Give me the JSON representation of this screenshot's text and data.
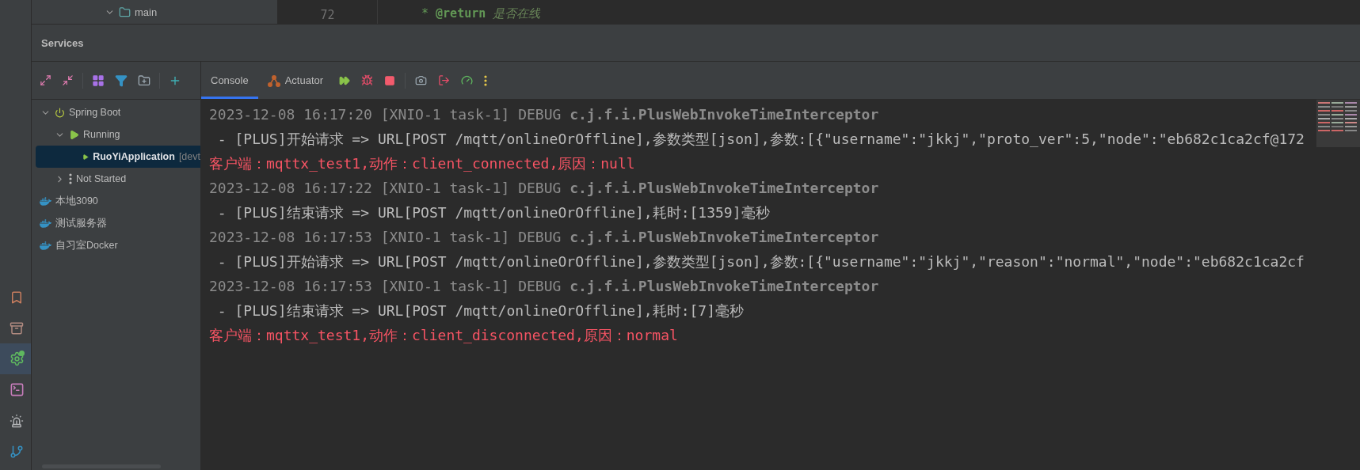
{
  "project_tree": {
    "label": "main",
    "expanded": true
  },
  "editor": {
    "line_number": "72",
    "code": "* **@return** *是否在线*"
  },
  "tool_strip": [
    {
      "kind": "bookmarks",
      "selected": false
    },
    {
      "kind": "archive",
      "selected": false
    },
    {
      "kind": "services",
      "selected": true
    },
    {
      "kind": "terminal",
      "selected": false
    },
    {
      "kind": "alarm",
      "selected": false
    },
    {
      "kind": "git",
      "selected": false
    }
  ],
  "services": {
    "title": "Services",
    "toolbar": [
      {
        "kind": "expand"
      },
      {
        "kind": "collapse"
      },
      {
        "kind": "group"
      },
      {
        "kind": "filter"
      },
      {
        "kind": "add-folder"
      },
      {
        "kind": "add"
      }
    ],
    "tree": [
      {
        "label": "Spring Boot",
        "kind": "spring",
        "expanded": true,
        "selected": false,
        "children": [
          {
            "label": "Running",
            "kind": "running",
            "expanded": true,
            "selected": false,
            "children": [
              {
                "label": "RuoYiApplication",
                "suffix": "[devt",
                "kind": "app",
                "selected": true
              }
            ]
          },
          {
            "label": "Not Started",
            "kind": "not-started",
            "expanded": false,
            "selected": false
          }
        ]
      },
      {
        "label": "本地3090",
        "kind": "docker",
        "selected": false
      },
      {
        "label": "测试服务器",
        "kind": "docker",
        "selected": false
      },
      {
        "label": "自习室Docker",
        "kind": "docker",
        "selected": false
      }
    ]
  },
  "tabs": [
    {
      "label": "Console",
      "kind": "console",
      "selected": true
    },
    {
      "label": "Actuator",
      "kind": "actuator",
      "selected": false
    }
  ],
  "actions": [
    {
      "kind": "rerun"
    },
    {
      "kind": "debug"
    },
    {
      "kind": "stop"
    },
    {
      "kind": "screenshot"
    },
    {
      "kind": "exit"
    },
    {
      "kind": "gauge"
    },
    {
      "kind": "more"
    }
  ],
  "console": [
    {
      "kind": "debug",
      "text": "2023-12-08 16:17:20 [XNIO-1 task-1] DEBUG ",
      "logger": "c.j.f.i.PlusWebInvokeTimeInterceptor"
    },
    {
      "kind": "info",
      "text": " - [PLUS]开始请求 => URL[POST /mqtt/onlineOrOffline],参数类型[json],参数:[{\"username\":\"jkkj\",\"proto_ver\":5,\"node\":\"eb682c1ca2cf@172"
    },
    {
      "kind": "error",
      "text": "客户端：mqttx_test1,动作：client_connected,原因：null"
    },
    {
      "kind": "debug",
      "text": "2023-12-08 16:17:22 [XNIO-1 task-1] DEBUG ",
      "logger": "c.j.f.i.PlusWebInvokeTimeInterceptor"
    },
    {
      "kind": "info",
      "text": " - [PLUS]结束请求 => URL[POST /mqtt/onlineOrOffline],耗时:[1359]毫秒"
    },
    {
      "kind": "debug",
      "text": "2023-12-08 16:17:53 [XNIO-1 task-1] DEBUG ",
      "logger": "c.j.f.i.PlusWebInvokeTimeInterceptor"
    },
    {
      "kind": "info",
      "text": " - [PLUS]开始请求 => URL[POST /mqtt/onlineOrOffline],参数类型[json],参数:[{\"username\":\"jkkj\",\"reason\":\"normal\",\"node\":\"eb682c1ca2cf"
    },
    {
      "kind": "debug",
      "text": "2023-12-08 16:17:53 [XNIO-1 task-1] DEBUG ",
      "logger": "c.j.f.i.PlusWebInvokeTimeInterceptor"
    },
    {
      "kind": "info",
      "text": " - [PLUS]结束请求 => URL[POST /mqtt/onlineOrOffline],耗时:[7]毫秒"
    },
    {
      "kind": "error",
      "text": "客户端：mqttx_test1,动作：client_disconnected,原因：normal"
    }
  ]
}
